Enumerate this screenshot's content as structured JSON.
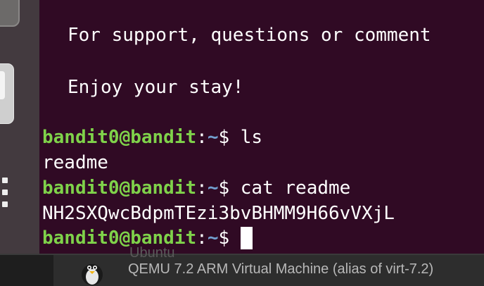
{
  "terminal": {
    "motd_support": "For support, questions or comment",
    "motd_enjoy": "Enjoy your stay!",
    "prompt_user": "bandit0@bandit",
    "prompt_sep": ":",
    "prompt_path": "~",
    "prompt_symbol": "$",
    "cmd_ls": "ls",
    "out_ls": "readme",
    "cmd_cat": "cat readme",
    "out_cat": "NH2SXQwcBdpmTEzi3bvBHMM9H66vVXjL"
  },
  "taskbar": {
    "vm_ghost_title": "Ubuntu",
    "vm_label": "QEMU 7.2 ARM Virtual Machine (alias of virt-7.2)"
  },
  "icons": [
    "terminal-app-icon",
    "text-editor-icon",
    "show-apps-icon",
    "tux-icon"
  ]
}
